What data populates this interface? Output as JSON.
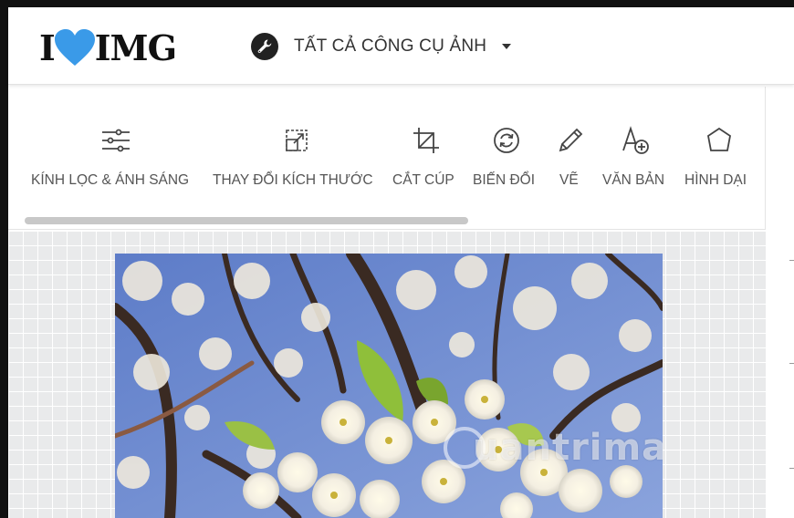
{
  "header": {
    "logo": {
      "left_text": "I",
      "right_text": "IMG",
      "heart_color": "#3a9ae8"
    },
    "tools_menu": {
      "label": "TẤT CẢ CÔNG CỤ ẢNH",
      "icon": "wrench-icon"
    }
  },
  "toolbar": {
    "tools": [
      {
        "label": "KÍNH LỌC & ÁNH SÁNG",
        "icon": "sliders-icon"
      },
      {
        "label": "THAY ĐỔI KÍCH THƯỚC",
        "icon": "resize-icon"
      },
      {
        "label": "CẮT CÚP",
        "icon": "crop-icon"
      },
      {
        "label": "BIẾN ĐỔI",
        "icon": "rotate-icon"
      },
      {
        "label": "VẼ",
        "icon": "pencil-icon"
      },
      {
        "label": "VĂN BẢN",
        "icon": "text-add-icon"
      },
      {
        "label": "HÌNH DẠI",
        "icon": "shape-icon"
      }
    ]
  },
  "canvas": {
    "image": "cherry-blossom-photo",
    "watermark": "uantrimang"
  },
  "colors": {
    "accent": "#3a9ae8",
    "text": "#555555",
    "canvas_bg": "#e9eaeb"
  }
}
